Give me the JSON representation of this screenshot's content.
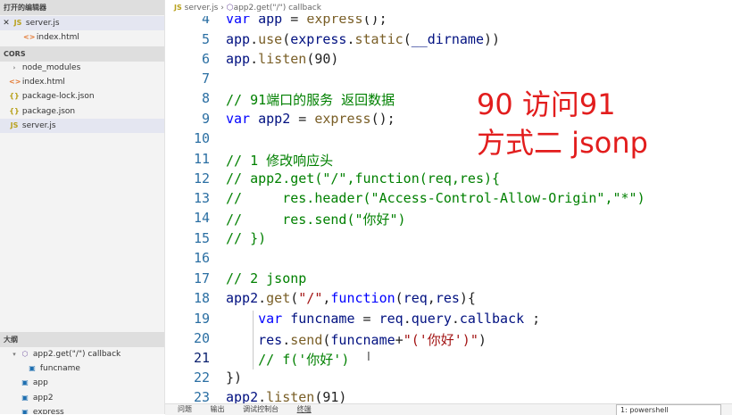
{
  "sidebar": {
    "open_editors_title": "打开的编辑器",
    "open_editors": [
      {
        "label": "server.js",
        "type": "JS",
        "close": "✕",
        "selected": true
      },
      {
        "label": "index.html",
        "type": "<>"
      }
    ],
    "project_title": "CORS",
    "files": [
      {
        "label": "node_modules",
        "type": "›"
      },
      {
        "label": "index.html",
        "type": "<>"
      },
      {
        "label": "package-lock.json",
        "type": "{}"
      },
      {
        "label": "package.json",
        "type": "{}"
      },
      {
        "label": "server.js",
        "type": "JS",
        "selected": true
      }
    ],
    "outline_title": "大纲",
    "outline": [
      {
        "label": "app2.get(\"/\") callback"
      },
      {
        "label": "funcname"
      },
      {
        "label": "app"
      },
      {
        "label": "app2"
      },
      {
        "label": "express"
      }
    ]
  },
  "breadcrumb": {
    "file_type": "JS",
    "file": "server.js",
    "separator": "›",
    "symbol": "app2.get(\"/\") callback"
  },
  "code_lines": [
    {
      "n": "4"
    },
    {
      "n": "5"
    },
    {
      "n": "6"
    },
    {
      "n": "7"
    },
    {
      "n": "8"
    },
    {
      "n": "9"
    },
    {
      "n": "10"
    },
    {
      "n": "11"
    },
    {
      "n": "12"
    },
    {
      "n": "13"
    },
    {
      "n": "14"
    },
    {
      "n": "15"
    },
    {
      "n": "16"
    },
    {
      "n": "17"
    },
    {
      "n": "18"
    },
    {
      "n": "19"
    },
    {
      "n": "20"
    },
    {
      "n": "21"
    },
    {
      "n": "22"
    },
    {
      "n": "23"
    }
  ],
  "annotation": {
    "line1": "90 访问91",
    "line2": "方式二  jsonp"
  },
  "bottom_panel": {
    "tabs": [
      "问题",
      "输出",
      "调试控制台",
      "终端"
    ],
    "terminal_select": "1: powershell"
  }
}
